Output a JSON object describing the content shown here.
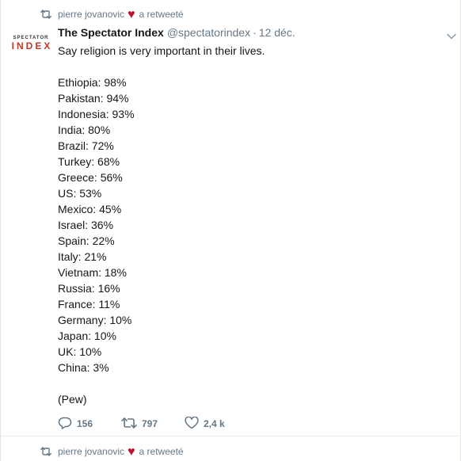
{
  "tweet": {
    "retweeter": "pierre jovanovic",
    "retweet_suffix": "a retweeté",
    "author": {
      "fullname": "The Spectator Index",
      "handle": "@spectatorindex",
      "avatar_top": "SPECTATOR",
      "avatar_bottom": "INDEX"
    },
    "separator": "·",
    "timestamp": "12 déc.",
    "text": {
      "intro": "Say religion is very important in their lives.",
      "lines": [
        "Ethiopia: 98%",
        "Pakistan: 94%",
        "Indonesia: 93%",
        "India: 80%",
        "Brazil: 72%",
        "Turkey: 68%",
        "Greece: 56%",
        "US: 53%",
        "Mexico: 45%",
        "Israel: 36%",
        "Spain: 22%",
        "Italy: 21%",
        "Vietnam: 18%",
        "Russia: 16%",
        "France: 11%",
        "Germany: 10%",
        "Japan: 10%",
        "UK: 10%",
        "China: 3%"
      ],
      "source": "(Pew)"
    },
    "actions": {
      "reply_count": "156",
      "retweet_count": "797",
      "like_count": "2,4 k"
    }
  },
  "next_tweet": {
    "retweeter": "pierre jovanovic",
    "retweet_suffix": "a retweeté"
  },
  "colors": {
    "secondary_text": "#657786",
    "heart": "#b8142f",
    "brand_index": "#c0392b",
    "border": "#e6ecf0"
  }
}
